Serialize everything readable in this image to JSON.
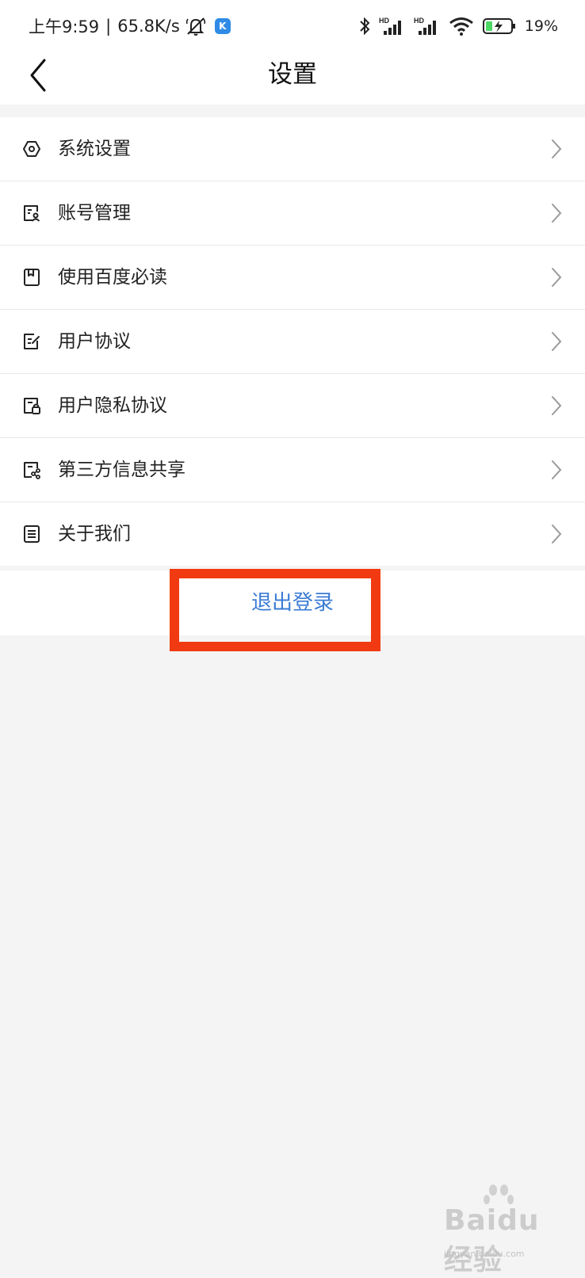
{
  "status_bar": {
    "time": "上午9:59",
    "separator": "|",
    "net_speed": "65.8K/s",
    "battery": "19%",
    "icons": [
      "mute-bell-icon",
      "k-app-icon",
      "bluetooth-icon",
      "signal-hd-icon",
      "signal-hd-icon",
      "wifi-icon",
      "battery-charging-icon"
    ]
  },
  "header": {
    "title": "设置",
    "back_icon": "chevron-left-icon"
  },
  "menu": {
    "items": [
      {
        "label": "系统设置",
        "icon": "hexagon-settings-icon"
      },
      {
        "label": "账号管理",
        "icon": "account-card-icon"
      },
      {
        "label": "使用百度必读",
        "icon": "bookmark-book-icon"
      },
      {
        "label": "用户协议",
        "icon": "agreement-edit-icon"
      },
      {
        "label": "用户隐私协议",
        "icon": "privacy-lock-icon"
      },
      {
        "label": "第三方信息共享",
        "icon": "share-nodes-icon"
      },
      {
        "label": "关于我们",
        "icon": "document-lines-icon"
      }
    ],
    "chevron_icon": "chevron-right-icon"
  },
  "logout": {
    "label": "退出登录",
    "color": "#3a7bd5"
  },
  "annotation": {
    "highlight_color": "#f23a12"
  },
  "watermark": {
    "brand": "Baidu 经验",
    "sub": "jingyan.baidu.com"
  }
}
